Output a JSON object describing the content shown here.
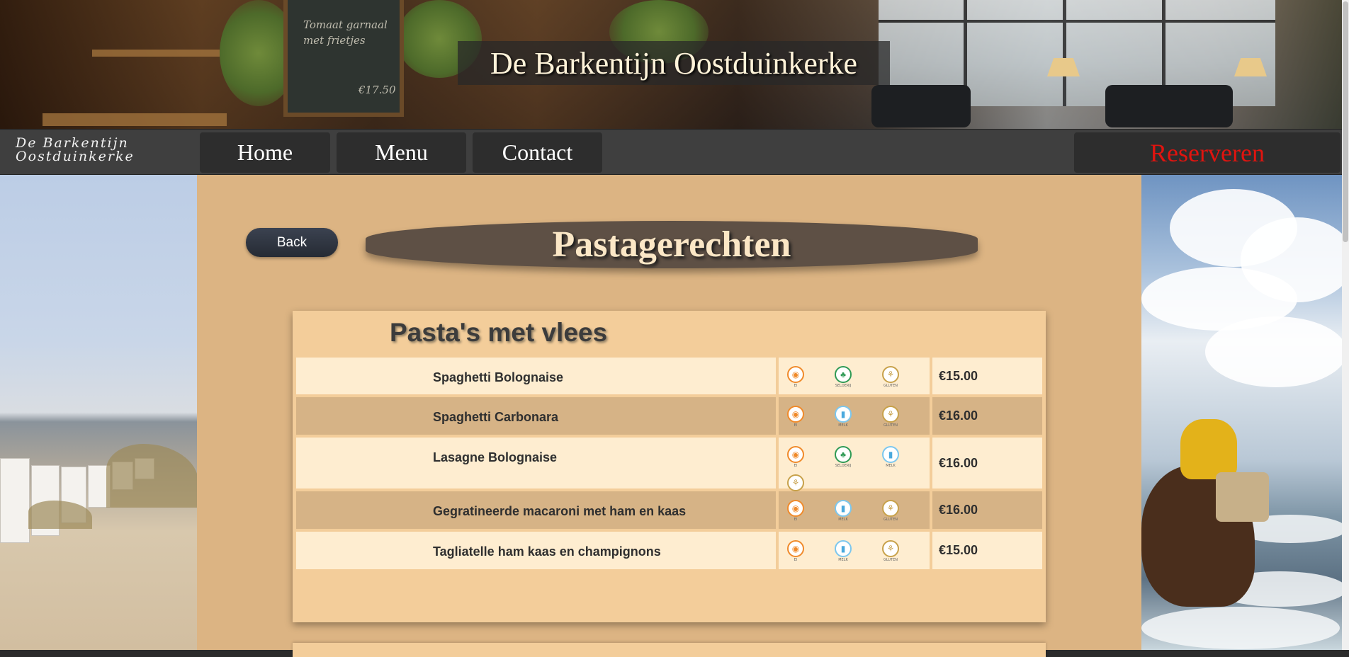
{
  "banner": {
    "title": "De Barkentijn Oostduinkerke",
    "chalkboard_lines": [
      "Tomaat garnaal",
      "met frietjes",
      "€17.50"
    ]
  },
  "nav": {
    "brand_line1": "De Barkentijn",
    "brand_line2": "Oostduinkerke",
    "home": "Home",
    "menu": "Menu",
    "contact": "Contact",
    "reserve": "Reserveren",
    "reserve_color": "#e0140f"
  },
  "page": {
    "back_label": "Back",
    "title": "Pastagerechten",
    "section_title": "Pasta's met vlees"
  },
  "allergen_labels": {
    "ei": "EI",
    "selderij": "SELDERIJ",
    "gluten": "GLUTEN",
    "melk": "MELK"
  },
  "dishes": [
    {
      "name": "Spaghetti Bolognaise",
      "allergens": [
        "ei",
        "selderij",
        "gluten"
      ],
      "price": "€15.00"
    },
    {
      "name": "Spaghetti Carbonara",
      "allergens": [
        "ei",
        "melk",
        "gluten"
      ],
      "price": "€16.00"
    },
    {
      "name": "Lasagne Bolognaise",
      "allergens": [
        "ei",
        "selderij",
        "melk",
        "gluten"
      ],
      "price": "€16.00"
    },
    {
      "name": "Gegratineerde macaroni met ham en kaas",
      "allergens": [
        "ei",
        "melk",
        "gluten"
      ],
      "price": "€16.00"
    },
    {
      "name": "Tagliatelle ham kaas en champignons",
      "allergens": [
        "ei",
        "melk",
        "gluten"
      ],
      "price": "€15.00"
    }
  ],
  "colors": {
    "panel_bg": "#dcb483",
    "row_light": "#feedd0",
    "row_dark": "#d6b386",
    "title_pill": "#5e5045",
    "nav_bg": "#3f3f3f"
  },
  "icons": {
    "ei": "egg-icon",
    "selderij": "celery-icon",
    "gluten": "wheat-icon",
    "melk": "milk-icon"
  }
}
